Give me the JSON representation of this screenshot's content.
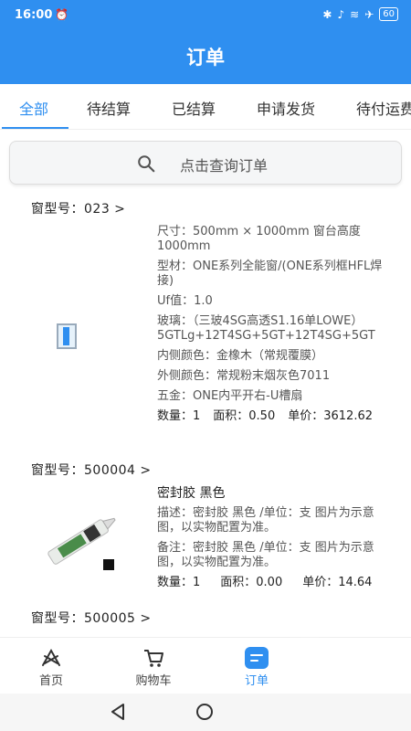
{
  "status": {
    "time": "16:00",
    "alarm_icon": "alarm-icon",
    "battery": "60"
  },
  "header": {
    "title": "订单"
  },
  "tabs": [
    {
      "label": "全部",
      "active": true
    },
    {
      "label": "待结算"
    },
    {
      "label": "已结算"
    },
    {
      "label": "申请发货"
    },
    {
      "label": "待付运费"
    }
  ],
  "search": {
    "placeholder": "点击查询订单"
  },
  "orders": [
    {
      "title": "窗型号：023 >",
      "size": "尺寸：500mm × 1000mm 窗台高度1000mm",
      "profile": "型材：ONE系列全能窗/(ONE系列框HFL焊接)",
      "uf": "Uf值：1.0",
      "glass": "玻璃：（三玻4SG高透S1.16单LOWE）5GTLg+12T4SG+5GT+12T4SG+5GT",
      "inner_color": "内侧颜色：金橡木（常规覆膜）",
      "outer_color": "外侧颜色：常规粉末烟灰色7011",
      "hardware": "五金：ONE内平开右-U槽扇",
      "qty": "数量：1",
      "area": "面积：0.50",
      "price": "单价：3612.62"
    },
    {
      "title": "窗型号：500004 >",
      "name": "密封胶 黑色",
      "desc": "描述：密封胶 黑色 /单位：支 图片为示意图，以实物配置为准。",
      "note": "备注：密封胶 黑色 /单位：支 图片为示意图，以实物配置为准。",
      "qty": "数量：1",
      "area": "面积：0.00",
      "price": "单价：14.64"
    },
    {
      "title": "窗型号：500005 >"
    }
  ],
  "tabbar": [
    {
      "label": "首页",
      "icon": "home-icon"
    },
    {
      "label": "购物车",
      "icon": "cart-icon"
    },
    {
      "label": "订单",
      "icon": "order-icon",
      "active": true
    }
  ],
  "colors": {
    "primary": "#2f8ff0"
  }
}
